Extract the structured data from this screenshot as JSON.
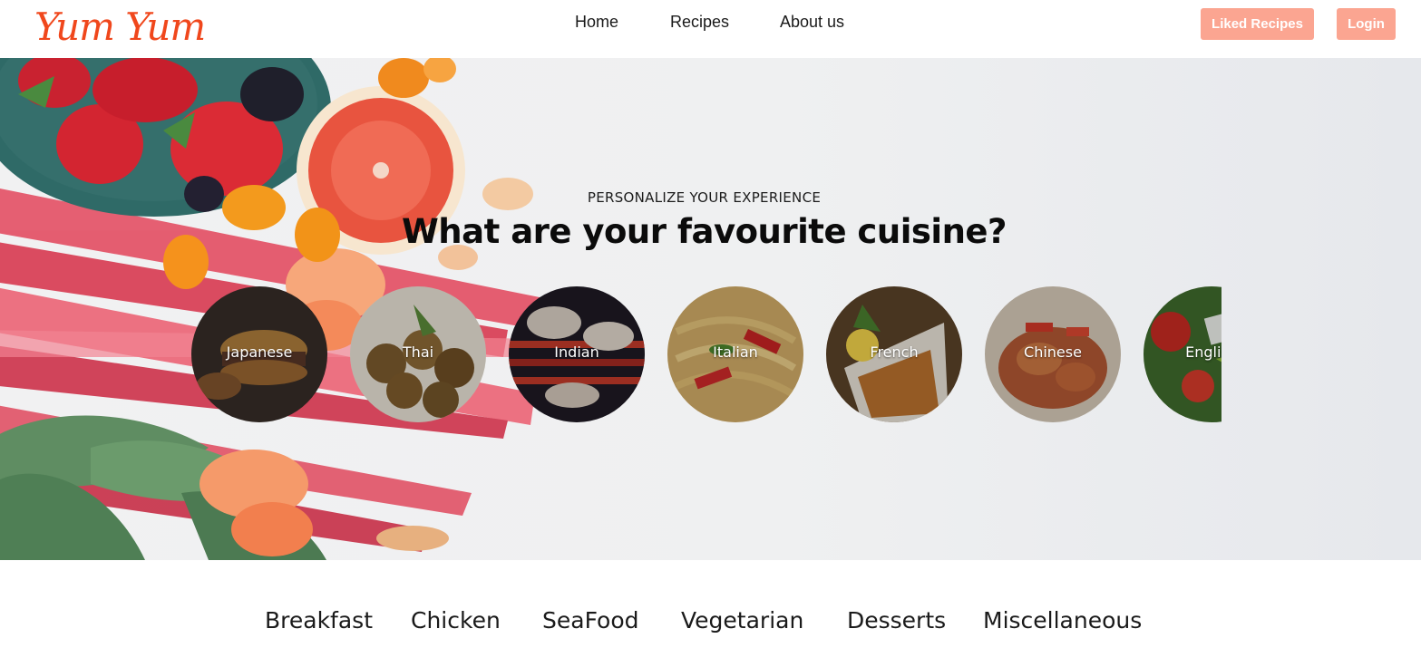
{
  "navbar": {
    "logo": "Yum Yum",
    "links": [
      "Home",
      "Recipes",
      "About us"
    ],
    "liked_label": "Liked Recipes",
    "login_label": "Login"
  },
  "hero": {
    "eyebrow": "PERSONALIZE YOUR EXPERIENCE",
    "headline": "What are your favourite cuisine?",
    "cuisines": [
      "Japanese",
      "Thai",
      "Indian",
      "Italian",
      "French",
      "Chinese",
      "English"
    ]
  },
  "categories": [
    "Breakfast",
    "Chicken",
    "SeaFood",
    "Vegetarian",
    "Desserts",
    "Miscellaneous"
  ],
  "colors": {
    "brand": "#f0471c",
    "button": "#fba591",
    "hero_background": "#eff0f1"
  }
}
